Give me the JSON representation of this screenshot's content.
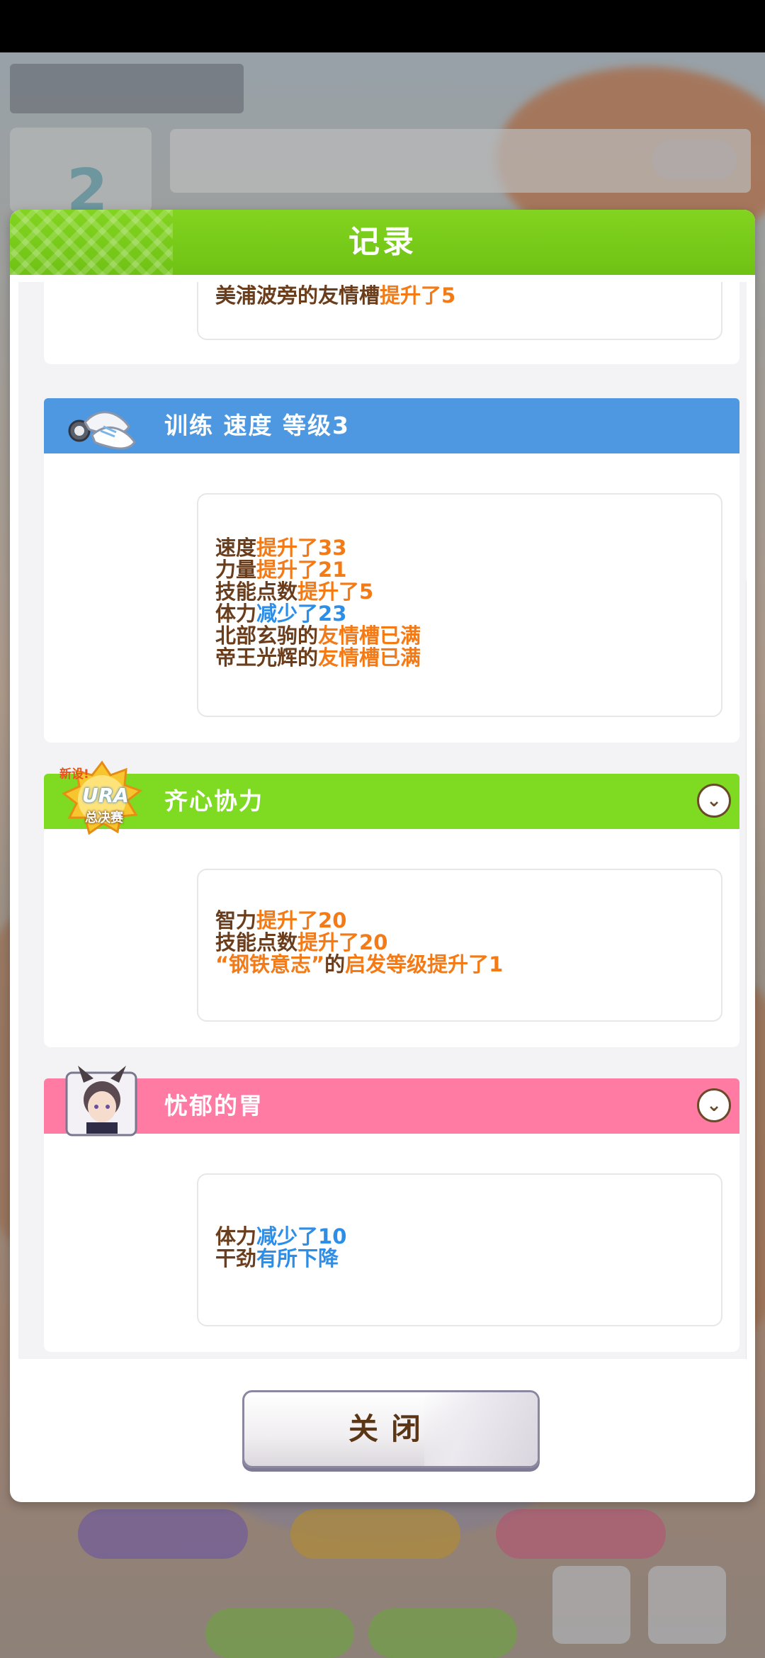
{
  "background": {
    "top_left_label": "",
    "date_number": "2"
  },
  "dialog": {
    "title": "记录",
    "cards": [
      {
        "id": "partial",
        "lines": [
          [
            {
              "t": "美浦波旁的友情槽",
              "c": "b"
            },
            {
              "t": "提升了5",
              "c": "o"
            }
          ]
        ]
      },
      {
        "id": "training",
        "title": "训练  速度  等级3",
        "icon": "shoes-stopwatch-icon",
        "bar_color": "#4d98e0",
        "lines": [
          [
            {
              "t": "速度",
              "c": "b"
            },
            {
              "t": "提升了33",
              "c": "o"
            }
          ],
          [
            {
              "t": "力量",
              "c": "b"
            },
            {
              "t": "提升了21",
              "c": "o"
            }
          ],
          [
            {
              "t": "技能点数",
              "c": "b"
            },
            {
              "t": "提升了5",
              "c": "o"
            }
          ],
          [
            {
              "t": "体力",
              "c": "b"
            },
            {
              "t": "减少了23",
              "c": "bl"
            }
          ],
          [
            {
              "t": "北部玄驹的",
              "c": "b"
            },
            {
              "t": "友情槽已满",
              "c": "o"
            }
          ],
          [
            {
              "t": "帝王光辉的",
              "c": "b"
            },
            {
              "t": "友情槽已满",
              "c": "o"
            }
          ]
        ]
      },
      {
        "id": "event-ura",
        "title": "齐心协力",
        "icon": "ura-finals-badge-icon",
        "icon_text": [
          "新设!",
          "URA",
          "总决赛"
        ],
        "bar_color": "#7fdb21",
        "lines": [
          [
            {
              "t": "智力",
              "c": "b"
            },
            {
              "t": "提升了20",
              "c": "o"
            }
          ],
          [
            {
              "t": "技能点数",
              "c": "b"
            },
            {
              "t": "提升了20",
              "c": "o"
            }
          ],
          [
            {
              "t": "“钢铁意志”",
              "c": "o"
            },
            {
              "t": "的",
              "c": "b"
            },
            {
              "t": "启发等级提升了1",
              "c": "o"
            }
          ]
        ]
      },
      {
        "id": "event-stomach",
        "title": "忧郁的胃",
        "icon": "character-portrait-icon",
        "bar_color": "#ff7ba4",
        "lines": [
          [
            {
              "t": "体力",
              "c": "b"
            },
            {
              "t": "减少了10",
              "c": "bl"
            }
          ],
          [
            {
              "t": "干劲",
              "c": "b"
            },
            {
              "t": "有所下降",
              "c": "bl"
            }
          ]
        ]
      }
    ],
    "close_label": "关闭"
  }
}
